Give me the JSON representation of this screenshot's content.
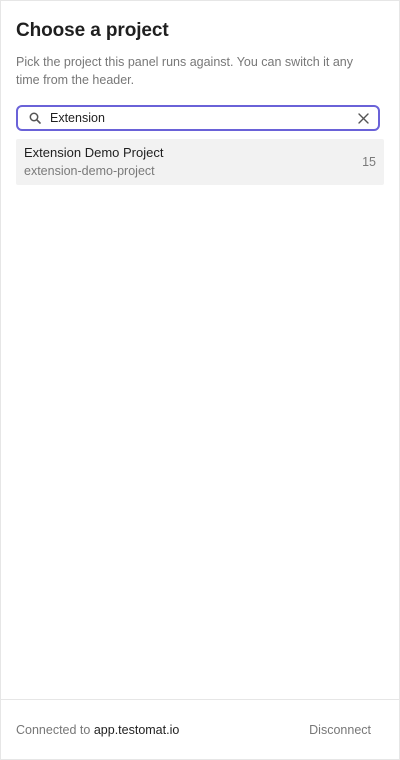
{
  "header": {
    "title": "Choose a project",
    "description": "Pick the project this panel runs against. You can switch it any time from the header."
  },
  "search": {
    "value": "Extension",
    "icon": "search-icon",
    "clear_icon": "close-icon",
    "accent_color": "#6a62d8"
  },
  "projects": [
    {
      "name": "Extension Demo Project",
      "slug": "extension-demo-project",
      "count": "15"
    }
  ],
  "footer": {
    "connected_label": "Connected to",
    "host": "app.testomat.io",
    "disconnect_label": "Disconnect"
  }
}
